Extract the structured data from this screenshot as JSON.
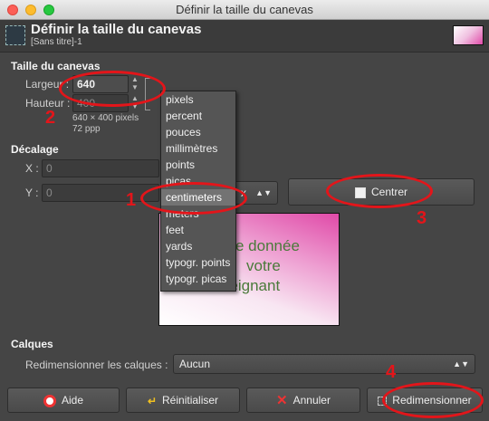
{
  "window": {
    "title": "Définir la taille du canevas"
  },
  "header": {
    "title": "Définir la taille du canevas",
    "subtitle": "[Sans titre]-1"
  },
  "canvas_size": {
    "section": "Taille du canevas",
    "width_label": "Largeur :",
    "width_value": "640",
    "height_label": "Hauteur :",
    "height_value": "400",
    "info_pixels": "640 × 400 pixels",
    "info_ppp": "72 ppp"
  },
  "unit_dropdown": {
    "selected": "centimeters",
    "options": [
      "pixels",
      "percent",
      "pouces",
      "millimètres",
      "points",
      "picas",
      "centimeters",
      "meters",
      "feet",
      "yards",
      "typogr. points",
      "typogr. picas"
    ],
    "partial_combo_text": "x"
  },
  "offset": {
    "section": "Décalage",
    "x_label": "X :",
    "x_value": "0",
    "y_label": "Y :",
    "y_value": "0",
    "center_button": "Centrer"
  },
  "preview": {
    "line1": "e donnée",
    "line2": "votre",
    "line3": "enseignant"
  },
  "layers": {
    "section": "Calques",
    "resize_label": "Redimensionner les calques :",
    "resize_value": "Aucun"
  },
  "buttons": {
    "help": "Aide",
    "reset": "Réinitialiser",
    "cancel": "Annuler",
    "resize": "Redimensionner"
  },
  "annotations": {
    "n1": "1",
    "n2": "2",
    "n3": "3",
    "n4": "4"
  },
  "colors": {
    "annotation": "#e3151a",
    "background": "#454545",
    "selected_item": "#737373"
  }
}
